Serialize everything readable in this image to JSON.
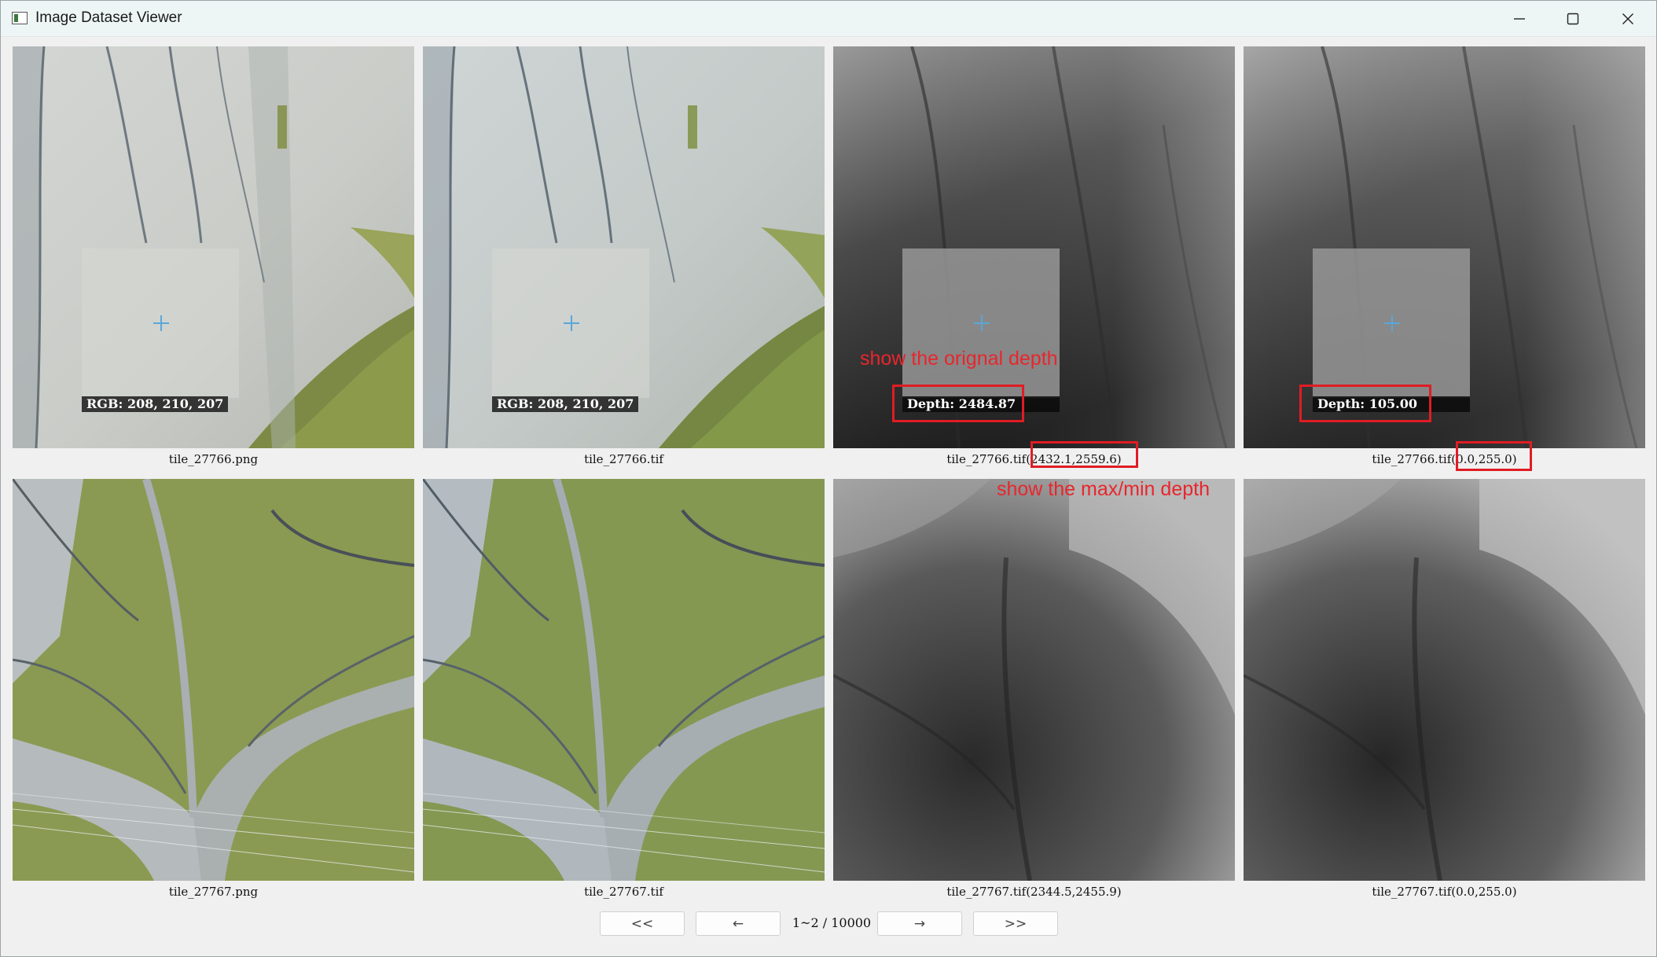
{
  "window": {
    "title": "Image Dataset Viewer",
    "minimize_icon": "minimize-icon",
    "maximize_icon": "maximize-icon",
    "close_icon": "close-icon"
  },
  "tiles": {
    "r1c1": {
      "caption": "tile_27766.png",
      "readout": "RGB: 208, 210, 207"
    },
    "r1c2": {
      "caption": "tile_27766.tif",
      "readout": "RGB: 208, 210, 207"
    },
    "r1c3": {
      "caption_name": "tile_27766.tif",
      "caption_range": "(2432.1,2559.6)",
      "readout": "Depth: 2484.87"
    },
    "r1c4": {
      "caption_name": "tile_27766.tif",
      "caption_range": "(0.0,255.0)",
      "readout": "Depth: 105.00"
    },
    "r2c1": {
      "caption": "tile_27767.png"
    },
    "r2c2": {
      "caption": "tile_27767.tif"
    },
    "r2c3": {
      "caption": "tile_27767.tif(2344.5,2455.9)"
    },
    "r2c4": {
      "caption": "tile_27767.tif(0.0,255.0)"
    }
  },
  "annotations": {
    "original_depth": "show the orignal depth",
    "max_min_depth": "show the max/min depth",
    "color": "#e01c24"
  },
  "pagination": {
    "first_label": "<<",
    "prev_label": "←",
    "page_text": "1~2 / 10000",
    "next_label": "→",
    "last_label": ">>"
  }
}
